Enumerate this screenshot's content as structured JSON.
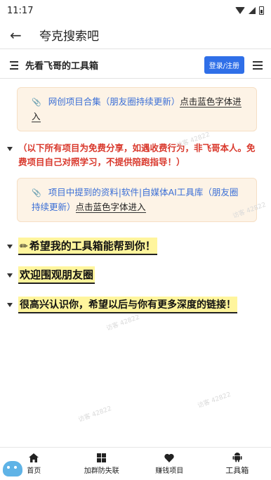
{
  "status_bar": {
    "time": "11:17"
  },
  "app_bar": {
    "title": "夸克搜索吧"
  },
  "site_header": {
    "title": "先看飞哥的工具箱",
    "login_label": "登录/注册"
  },
  "content": {
    "callout_1": {
      "link_text": "网创项目合集（朋友圈持续更新）",
      "plain_text": "点击蓝色字体进入"
    },
    "notice": "（以下所有项目为免费分享，如遇收费行为，非飞哥本人。免费项目自己对照学习，不提供陪跑指导！）",
    "callout_2": {
      "link_text": "项目中提到的资料|软件|自媒体AI工具库（朋友圈持续更新）",
      "plain_text": "点击蓝色字体进入"
    },
    "headings": [
      "希望我的工具箱能帮到你！",
      "欢迎围观朋友圈",
      "很高兴认识你，希望以后与你有更多深度的链接！"
    ],
    "watermark": "访客 42822"
  },
  "bottom_nav": {
    "items": [
      {
        "label": "首页",
        "icon": "home-icon"
      },
      {
        "label": "加群防失联",
        "icon": "grid-icon"
      },
      {
        "label": "赚钱项目",
        "icon": "heart-icon"
      },
      {
        "label": "工具箱",
        "icon": "android-icon"
      }
    ]
  }
}
